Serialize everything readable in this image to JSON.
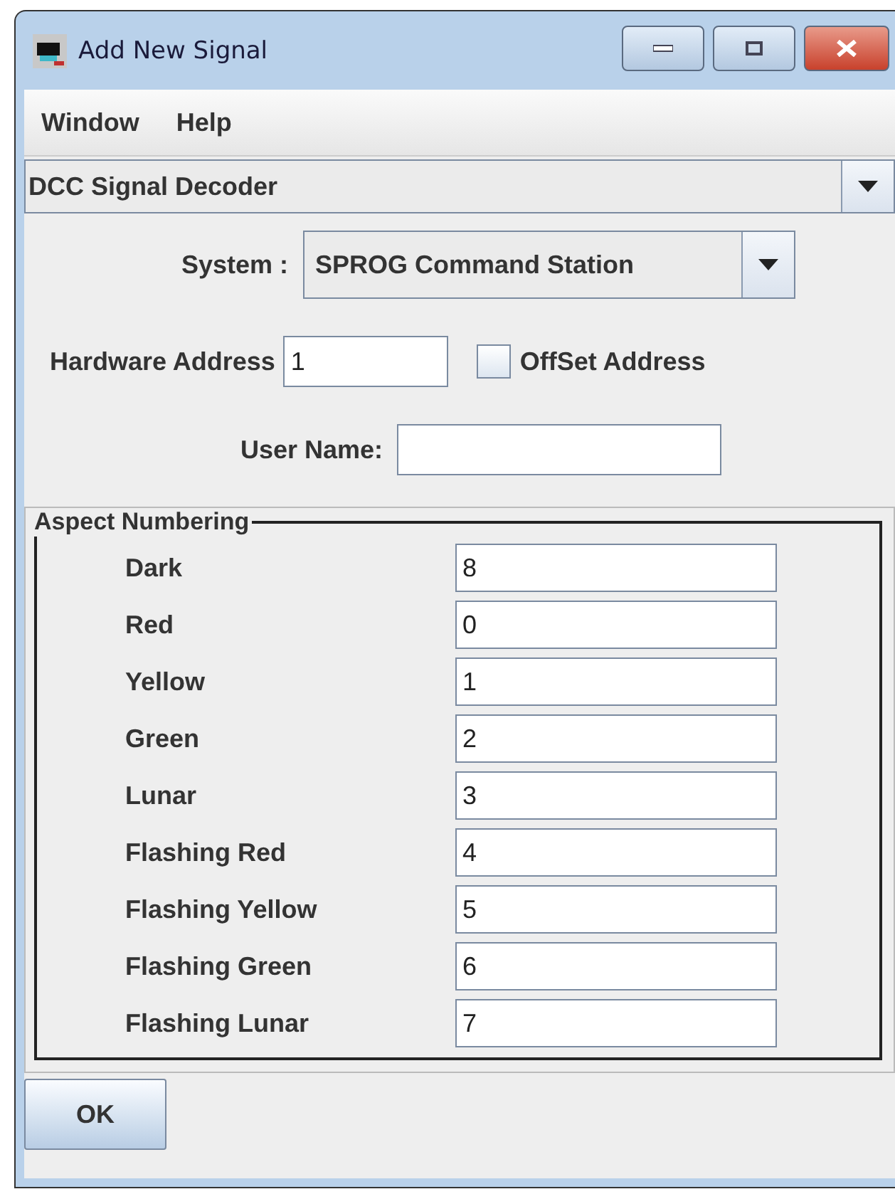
{
  "window": {
    "title": "Add New Signal"
  },
  "menu": [
    "Window",
    "Help"
  ],
  "type_select": {
    "value": "DCC Signal Decoder"
  },
  "system": {
    "label": "System :",
    "value": "SPROG Command Station"
  },
  "hardware_address": {
    "label": "Hardware Address",
    "value": "1"
  },
  "offset_address": {
    "label": "OffSet Address",
    "checked": false
  },
  "user_name": {
    "label": "User Name:"
  },
  "aspect_numbering": {
    "title": "Aspect Numbering",
    "rows": [
      {
        "name": "Dark",
        "value": "8"
      },
      {
        "name": "Red",
        "value": "0"
      },
      {
        "name": "Yellow",
        "value": "1"
      },
      {
        "name": "Green",
        "value": "2"
      },
      {
        "name": "Lunar",
        "value": "3"
      },
      {
        "name": "Flashing Red",
        "value": "4"
      },
      {
        "name": "Flashing Yellow",
        "value": "5"
      },
      {
        "name": "Flashing Green",
        "value": "6"
      },
      {
        "name": "Flashing Lunar",
        "value": "7"
      }
    ]
  },
  "buttons": [
    "OK"
  ]
}
